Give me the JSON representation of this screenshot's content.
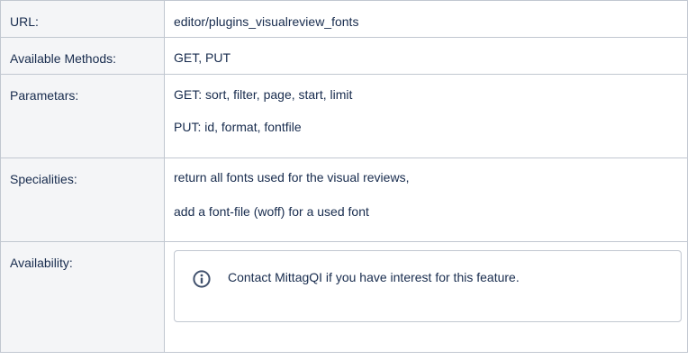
{
  "rows": [
    {
      "key": "URL:",
      "values": [
        "editor/plugins_visualreview_fonts"
      ]
    },
    {
      "key": "Available Methods:",
      "values": [
        "GET, PUT"
      ]
    },
    {
      "key": "Parametars:",
      "values": [
        "GET: sort, filter, page, start, limit",
        "PUT: id, format, fontfile"
      ]
    },
    {
      "key": "Specialities:",
      "values": [
        "return all fonts used for the visual reviews,",
        "add a font-file (woff) for a used font"
      ]
    },
    {
      "key": "Availability:",
      "info": {
        "icon": "info-icon",
        "text": "Contact MittagQI if you have interest for this feature."
      }
    }
  ],
  "colors": {
    "key_bg": "#f4f5f7",
    "border": "#c1c7d0",
    "text": "#172b4d",
    "icon": "#42526e"
  }
}
